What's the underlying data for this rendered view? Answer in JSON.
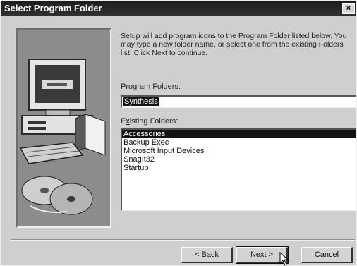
{
  "window": {
    "title": "Select Program Folder",
    "close_glyph": "×"
  },
  "description": "Setup will add program icons to the Program Folder listed below. You may type a new folder name, or select one from the existing Folders list. Click Next to continue.",
  "program_folders": {
    "label_accel": "P",
    "label_rest": "rogram Folders:",
    "value": "Synthesis"
  },
  "existing_folders": {
    "label_pre": "E",
    "label_accel": "x",
    "label_rest": "isting Folders:",
    "items": [
      {
        "label": "Accessories",
        "selected": true
      },
      {
        "label": "Backup Exec",
        "selected": false
      },
      {
        "label": "Microsoft Input Devices",
        "selected": false
      },
      {
        "label": "SnagIt32",
        "selected": false
      },
      {
        "label": "Startup",
        "selected": false
      }
    ]
  },
  "buttons": {
    "back_prefix": "< ",
    "back_accel": "B",
    "back_rest": "ack",
    "next_accel": "N",
    "next_rest": "ext >",
    "cancel": "Cancel"
  },
  "colors": {
    "selection": "#121212",
    "titlebar": "#1c1c1c"
  }
}
